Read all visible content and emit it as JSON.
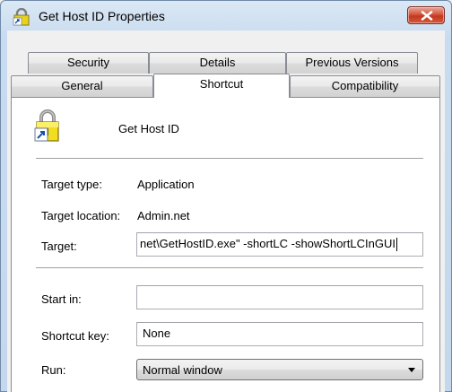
{
  "window": {
    "title": "Get Host ID Properties"
  },
  "tabs": {
    "row1": [
      {
        "label": "Security"
      },
      {
        "label": "Details"
      },
      {
        "label": "Previous Versions"
      }
    ],
    "row2": [
      {
        "label": "General"
      },
      {
        "label": "Shortcut"
      },
      {
        "label": "Compatibility"
      }
    ],
    "active": "Shortcut"
  },
  "shortcut": {
    "name": "Get Host ID",
    "target_type_label": "Target type:",
    "target_type": "Application",
    "target_location_label": "Target location:",
    "target_location": "Admin.net",
    "target_label": "Target:",
    "target_value": "net\\GetHostID.exe\" -shortLC -showShortLCInGUI",
    "start_in_label": "Start in:",
    "start_in_value": "",
    "shortcut_key_label": "Shortcut key:",
    "shortcut_key_value": "None",
    "run_label": "Run:",
    "run_value": "Normal window"
  },
  "icons": {
    "title": "shortcut-lock-icon",
    "app": "lock-shortcut-icon",
    "close": "close-icon",
    "dropdown": "chevron-down-icon"
  },
  "colors": {
    "close_button": "#c3381f",
    "panel": "#ffffff",
    "titlebar": "#c9dcef"
  }
}
